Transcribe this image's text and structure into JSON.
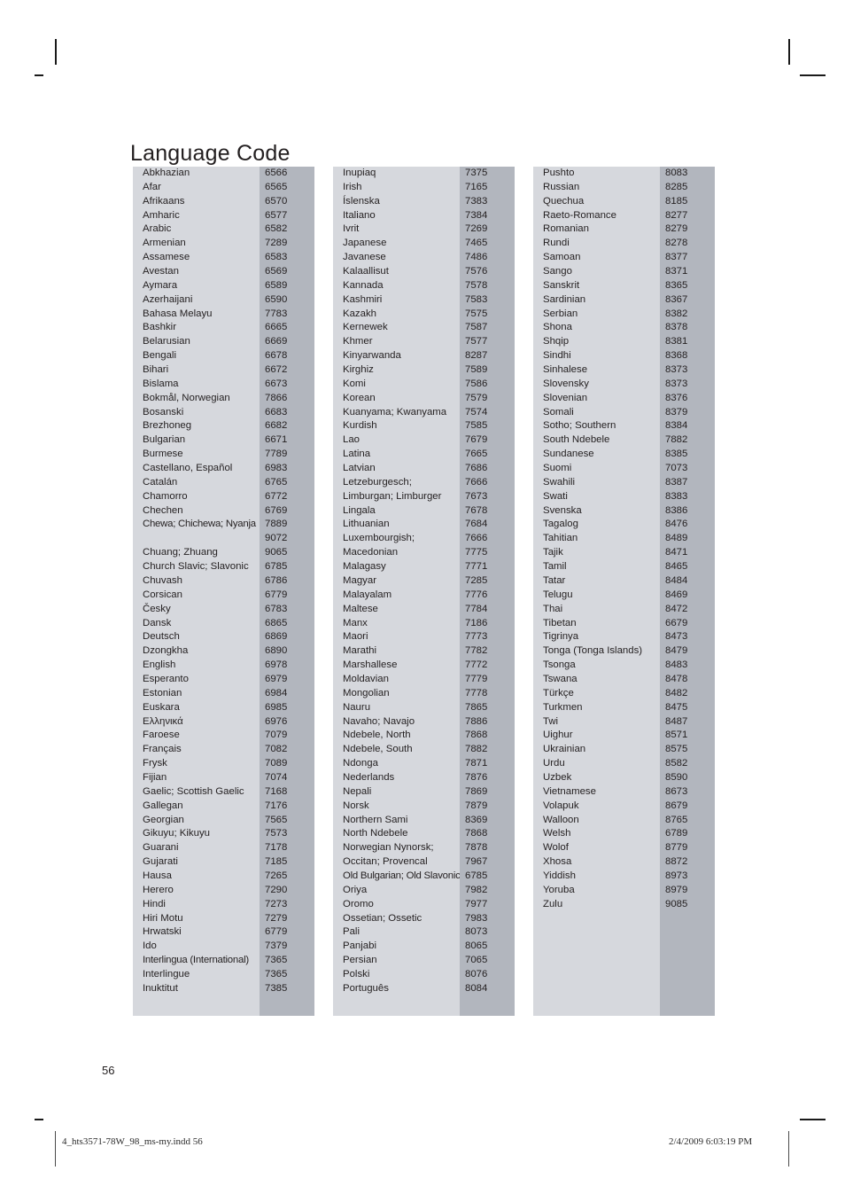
{
  "page": {
    "title": "Language Code",
    "page_number": "56"
  },
  "footer": {
    "filename": "4_hts3571-78W_98_ms-my.indd   56",
    "timestamp": "2/4/2009   6:03:19 PM"
  },
  "colors": {
    "name_band": "#d6d8dd",
    "code_band": "#b2b6be",
    "text": "#231f20",
    "page_background": "#ffffff"
  },
  "columns": [
    {
      "id": "column-1",
      "rows": [
        {
          "name": "Abkhazian",
          "code": "6566"
        },
        {
          "name": "Afar",
          "code": "6565"
        },
        {
          "name": "Afrikaans",
          "code": "6570"
        },
        {
          "name": "Amharic",
          "code": "6577"
        },
        {
          "name": "Arabic",
          "code": "6582"
        },
        {
          "name": "Armenian",
          "code": "7289"
        },
        {
          "name": "Assamese",
          "code": "6583"
        },
        {
          "name": "Avestan",
          "code": "6569"
        },
        {
          "name": "Aymara",
          "code": "6589"
        },
        {
          "name": "Azerhaijani",
          "code": "6590"
        },
        {
          "name": "Bahasa Melayu",
          "code": "7783"
        },
        {
          "name": "Bashkir",
          "code": "6665"
        },
        {
          "name": "Belarusian",
          "code": "6669"
        },
        {
          "name": "Bengali",
          "code": "6678"
        },
        {
          "name": "Bihari",
          "code": "6672"
        },
        {
          "name": "Bislama",
          "code": "6673"
        },
        {
          "name": "Bokmål, Norwegian",
          "code": "7866"
        },
        {
          "name": "Bosanski",
          "code": "6683"
        },
        {
          "name": "Brezhoneg",
          "code": "6682"
        },
        {
          "name": "Bulgarian",
          "code": "6671"
        },
        {
          "name": "Burmese",
          "code": "7789"
        },
        {
          "name": "Castellano, Español",
          "code": "6983"
        },
        {
          "name": "Catalán",
          "code": "6765"
        },
        {
          "name": "Chamorro",
          "code": "6772"
        },
        {
          "name": "Chechen",
          "code": "6769"
        },
        {
          "name": "Chewa; Chichewa; Nyanja",
          "code": "7889",
          "overflow": true
        },
        {
          "name": "",
          "code": "9072"
        },
        {
          "name": "Chuang; Zhuang",
          "code": "9065"
        },
        {
          "name": "Church Slavic; Slavonic",
          "code": "6785"
        },
        {
          "name": "Chuvash",
          "code": "6786"
        },
        {
          "name": "Corsican",
          "code": "6779"
        },
        {
          "name": "Česky",
          "code": "6783"
        },
        {
          "name": "Dansk",
          "code": "6865"
        },
        {
          "name": "Deutsch",
          "code": "6869"
        },
        {
          "name": "Dzongkha",
          "code": "6890"
        },
        {
          "name": "English",
          "code": "6978"
        },
        {
          "name": "Esperanto",
          "code": "6979"
        },
        {
          "name": "Estonian",
          "code": "6984"
        },
        {
          "name": "Euskara",
          "code": "6985"
        },
        {
          "name": "Ελληνικά",
          "code": "6976"
        },
        {
          "name": "Faroese",
          "code": "7079"
        },
        {
          "name": "Français",
          "code": "7082"
        },
        {
          "name": "Frysk",
          "code": "7089"
        },
        {
          "name": "Fijian",
          "code": "7074"
        },
        {
          "name": "Gaelic; Scottish Gaelic",
          "code": "7168"
        },
        {
          "name": "Gallegan",
          "code": "7176"
        },
        {
          "name": "Georgian",
          "code": "7565"
        },
        {
          "name": "Gikuyu; Kikuyu",
          "code": "7573"
        },
        {
          "name": "Guarani",
          "code": "7178"
        },
        {
          "name": "Gujarati",
          "code": "7185"
        },
        {
          "name": "Hausa",
          "code": "7265"
        },
        {
          "name": "Herero",
          "code": "7290"
        },
        {
          "name": "Hindi",
          "code": "7273"
        },
        {
          "name": "Hiri Motu",
          "code": "7279"
        },
        {
          "name": "Hrwatski",
          "code": "6779"
        },
        {
          "name": "Ido",
          "code": "7379"
        },
        {
          "name": "Interlingua (International)",
          "code": "7365",
          "overflow": true
        },
        {
          "name": "Interlingue",
          "code": "7365"
        },
        {
          "name": "Inuktitut",
          "code": "7385"
        }
      ]
    },
    {
      "id": "column-2",
      "rows": [
        {
          "name": "Inupiaq",
          "code": "7375"
        },
        {
          "name": "Irish",
          "code": "7165"
        },
        {
          "name": "Íslenska",
          "code": "7383"
        },
        {
          "name": "Italiano",
          "code": "7384"
        },
        {
          "name": "Ivrit",
          "code": "7269"
        },
        {
          "name": "Japanese",
          "code": "7465"
        },
        {
          "name": "Javanese",
          "code": "7486"
        },
        {
          "name": "Kalaallisut",
          "code": "7576"
        },
        {
          "name": "Kannada",
          "code": "7578"
        },
        {
          "name": "Kashmiri",
          "code": "7583"
        },
        {
          "name": "Kazakh",
          "code": "7575"
        },
        {
          "name": "Kernewek",
          "code": "7587"
        },
        {
          "name": "Khmer",
          "code": "7577"
        },
        {
          "name": "Kinyarwanda",
          "code": "8287"
        },
        {
          "name": "Kirghiz",
          "code": "7589"
        },
        {
          "name": "Komi",
          "code": "7586"
        },
        {
          "name": "Korean",
          "code": "7579"
        },
        {
          "name": "Kuanyama; Kwanyama",
          "code": "7574"
        },
        {
          "name": "Kurdish",
          "code": "7585"
        },
        {
          "name": "Lao",
          "code": "7679"
        },
        {
          "name": "Latina",
          "code": "7665"
        },
        {
          "name": "Latvian",
          "code": "7686"
        },
        {
          "name": "Letzeburgesch;",
          "code": "7666"
        },
        {
          "name": "Limburgan; Limburger",
          "code": "7673"
        },
        {
          "name": "Lingala",
          "code": "7678"
        },
        {
          "name": "Lithuanian",
          "code": "7684"
        },
        {
          "name": "Luxembourgish;",
          "code": "7666"
        },
        {
          "name": "Macedonian",
          "code": "7775"
        },
        {
          "name": "Malagasy",
          "code": "7771"
        },
        {
          "name": "Magyar",
          "code": "7285"
        },
        {
          "name": "Malayalam",
          "code": "7776"
        },
        {
          "name": "Maltese",
          "code": "7784"
        },
        {
          "name": "Manx",
          "code": "7186"
        },
        {
          "name": "Maori",
          "code": "7773"
        },
        {
          "name": "Marathi",
          "code": "7782"
        },
        {
          "name": "Marshallese",
          "code": "7772"
        },
        {
          "name": "Moldavian",
          "code": "7779"
        },
        {
          "name": "Mongolian",
          "code": "7778"
        },
        {
          "name": "Nauru",
          "code": "7865"
        },
        {
          "name": "Navaho; Navajo",
          "code": "7886"
        },
        {
          "name": "Ndebele, North",
          "code": "7868"
        },
        {
          "name": "Ndebele, South",
          "code": "7882"
        },
        {
          "name": "Ndonga",
          "code": "7871"
        },
        {
          "name": "Nederlands",
          "code": "7876"
        },
        {
          "name": "Nepali",
          "code": "7869"
        },
        {
          "name": "Norsk",
          "code": "7879"
        },
        {
          "name": "Northern Sami",
          "code": "8369"
        },
        {
          "name": "North Ndebele",
          "code": "7868"
        },
        {
          "name": "Norwegian Nynorsk;",
          "code": "7878"
        },
        {
          "name": "Occitan; Provencal",
          "code": "7967"
        },
        {
          "name": "Old Bulgarian; Old Slavonic",
          "code": "6785",
          "overflow": true
        },
        {
          "name": "Oriya",
          "code": "7982"
        },
        {
          "name": "Oromo",
          "code": "7977"
        },
        {
          "name": "Ossetian; Ossetic",
          "code": "7983"
        },
        {
          "name": "Pali",
          "code": "8073"
        },
        {
          "name": "Panjabi",
          "code": "8065"
        },
        {
          "name": "Persian",
          "code": "7065"
        },
        {
          "name": "Polski",
          "code": "8076"
        },
        {
          "name": "Português",
          "code": "8084"
        }
      ]
    },
    {
      "id": "column-3",
      "rows": [
        {
          "name": "Pushto",
          "code": "8083"
        },
        {
          "name": "Russian",
          "code": "8285"
        },
        {
          "name": "Quechua",
          "code": "8185"
        },
        {
          "name": "Raeto-Romance",
          "code": "8277"
        },
        {
          "name": "Romanian",
          "code": "8279"
        },
        {
          "name": "Rundi",
          "code": "8278"
        },
        {
          "name": "Samoan",
          "code": "8377"
        },
        {
          "name": "Sango",
          "code": "8371"
        },
        {
          "name": "Sanskrit",
          "code": "8365"
        },
        {
          "name": "Sardinian",
          "code": "8367"
        },
        {
          "name": "Serbian",
          "code": "8382"
        },
        {
          "name": "Shona",
          "code": "8378"
        },
        {
          "name": "Shqip",
          "code": "8381"
        },
        {
          "name": "Sindhi",
          "code": "8368"
        },
        {
          "name": "Sinhalese",
          "code": "8373"
        },
        {
          "name": "Slovensky",
          "code": "8373"
        },
        {
          "name": "Slovenian",
          "code": "8376"
        },
        {
          "name": "Somali",
          "code": "8379"
        },
        {
          "name": "Sotho; Southern",
          "code": "8384"
        },
        {
          "name": "South Ndebele",
          "code": "7882"
        },
        {
          "name": "Sundanese",
          "code": "8385"
        },
        {
          "name": "Suomi",
          "code": "7073"
        },
        {
          "name": "Swahili",
          "code": "8387"
        },
        {
          "name": "Swati",
          "code": "8383"
        },
        {
          "name": "Svenska",
          "code": "8386"
        },
        {
          "name": "Tagalog",
          "code": "8476"
        },
        {
          "name": "Tahitian",
          "code": "8489"
        },
        {
          "name": "Tajik",
          "code": "8471"
        },
        {
          "name": "Tamil",
          "code": "8465"
        },
        {
          "name": "Tatar",
          "code": "8484"
        },
        {
          "name": "Telugu",
          "code": "8469"
        },
        {
          "name": "Thai",
          "code": "8472"
        },
        {
          "name": "Tibetan",
          "code": "6679"
        },
        {
          "name": "Tigrinya",
          "code": "8473"
        },
        {
          "name": "Tonga (Tonga Islands)",
          "code": "8479"
        },
        {
          "name": "Tsonga",
          "code": "8483"
        },
        {
          "name": "Tswana",
          "code": "8478"
        },
        {
          "name": "Türkçe",
          "code": "8482"
        },
        {
          "name": "Turkmen",
          "code": "8475"
        },
        {
          "name": "Twi",
          "code": "8487"
        },
        {
          "name": "Uighur",
          "code": "8571"
        },
        {
          "name": "Ukrainian",
          "code": "8575"
        },
        {
          "name": "Urdu",
          "code": "8582"
        },
        {
          "name": "Uzbek",
          "code": "8590"
        },
        {
          "name": "Vietnamese",
          "code": "8673"
        },
        {
          "name": "Volapuk",
          "code": "8679"
        },
        {
          "name": "Walloon",
          "code": "8765"
        },
        {
          "name": "Welsh",
          "code": "6789"
        },
        {
          "name": "Wolof",
          "code": "8779"
        },
        {
          "name": "Xhosa",
          "code": "8872"
        },
        {
          "name": "Yiddish",
          "code": "8973"
        },
        {
          "name": "Yoruba",
          "code": "8979"
        },
        {
          "name": "Zulu",
          "code": "9085"
        }
      ]
    }
  ]
}
